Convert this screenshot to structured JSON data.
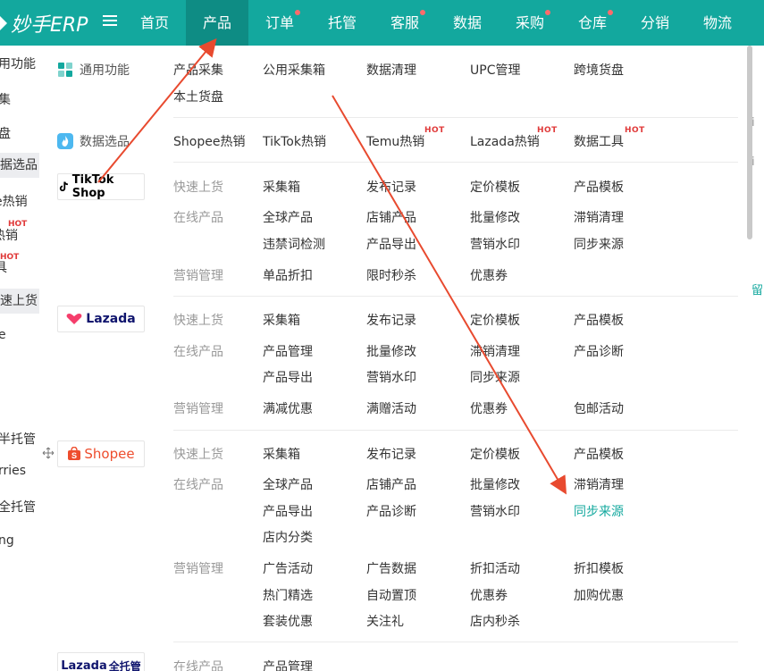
{
  "header": {
    "logo_text": "妙手ERP",
    "nav": [
      {
        "label": "首页",
        "dot": false,
        "active": false
      },
      {
        "label": "产品",
        "dot": false,
        "active": true
      },
      {
        "label": "订单",
        "dot": true,
        "active": false
      },
      {
        "label": "托管",
        "dot": false,
        "active": false
      },
      {
        "label": "客服",
        "dot": true,
        "active": false
      },
      {
        "label": "数据",
        "dot": false,
        "active": false
      },
      {
        "label": "采购",
        "dot": true,
        "active": false
      },
      {
        "label": "仓库",
        "dot": true,
        "active": false
      },
      {
        "label": "分销",
        "dot": false,
        "active": false
      },
      {
        "label": "物流",
        "dot": false,
        "active": false
      }
    ],
    "colors": {
      "bar": "#13a89e",
      "active": "#0e8c84",
      "dot": "#ff6b6b"
    }
  },
  "left_sidebar": {
    "items": [
      "用功能",
      "集",
      "盘",
      "据选品",
      "e热销",
      "热销",
      "具",
      "速上货",
      "e",
      "半托管",
      "rries",
      "全托管",
      "ng"
    ],
    "hot": "HOT"
  },
  "right_edge": {
    "texts": [
      "i",
      "i",
      "留"
    ]
  },
  "dropdown": {
    "general": {
      "label": "通用功能",
      "items": [
        "产品采集",
        "公用采集箱",
        "数据清理",
        "UPC管理",
        "跨境货盘",
        "本土货盘"
      ]
    },
    "data_selection": {
      "label": "数据选品",
      "items": [
        {
          "label": "Shopee热销",
          "hot": ""
        },
        {
          "label": "TikTok热销",
          "hot": ""
        },
        {
          "label": "Temu热销",
          "hot": "HOT"
        },
        {
          "label": "Lazada热销",
          "hot": "HOT"
        },
        {
          "label": "数据工具",
          "hot": "HOT"
        }
      ]
    },
    "tiktok": {
      "logo": "TikTok Shop",
      "rows": [
        {
          "cat": "快速上货",
          "items": [
            "采集箱",
            "发布记录",
            "定价模板",
            "产品模板"
          ]
        },
        {
          "cat": "在线产品",
          "items": [
            "全球产品",
            "店铺产品",
            "批量修改",
            "滞销清理"
          ]
        },
        {
          "cat": "",
          "items": [
            "违禁词检测",
            "产品导出",
            "营销水印",
            "同步来源"
          ]
        },
        {
          "cat": "营销管理",
          "items": [
            "单品折扣",
            "限时秒杀",
            "优惠券",
            ""
          ]
        }
      ]
    },
    "lazada": {
      "logo": "Lazada",
      "rows": [
        {
          "cat": "快速上货",
          "items": [
            "采集箱",
            "发布记录",
            "定价模板",
            "产品模板"
          ]
        },
        {
          "cat": "在线产品",
          "items": [
            "产品管理",
            "批量修改",
            "滞销清理",
            "产品诊断"
          ]
        },
        {
          "cat": "",
          "items": [
            "产品导出",
            "营销水印",
            "同步来源",
            ""
          ]
        },
        {
          "cat": "营销管理",
          "items": [
            "满减优惠",
            "满赠活动",
            "优惠券",
            "包邮活动"
          ]
        }
      ]
    },
    "shopee": {
      "logo": "Shopee",
      "rows": [
        {
          "cat": "快速上货",
          "items": [
            "采集箱",
            "发布记录",
            "定价模板",
            "产品模板"
          ]
        },
        {
          "cat": "在线产品",
          "items": [
            "全球产品",
            "店铺产品",
            "批量修改",
            "滞销清理"
          ]
        },
        {
          "cat": "",
          "items": [
            "产品导出",
            "产品诊断",
            "营销水印",
            "同步来源"
          ]
        },
        {
          "cat": "",
          "items": [
            "店内分类",
            "",
            "",
            ""
          ]
        },
        {
          "cat": "营销管理",
          "items": [
            "广告活动",
            "广告数据",
            "折扣活动",
            "折扣模板"
          ]
        },
        {
          "cat": "",
          "items": [
            "热门精选",
            "自动置顶",
            "优惠券",
            "加购优惠"
          ]
        },
        {
          "cat": "",
          "items": [
            "套装优惠",
            "关注礼",
            "店内秒杀",
            ""
          ]
        }
      ]
    },
    "lazada_full": {
      "logo_en": "Lazada",
      "logo_cn": "全托管",
      "rows": [
        {
          "cat": "在线产品",
          "items": [
            "产品管理"
          ]
        }
      ]
    }
  },
  "colors": {
    "accent": "#13a89e",
    "hot": "#e03a3a",
    "arrow": "#e84a2f",
    "tiktok_logo": "#000000",
    "lazada_logo": "#0f146d",
    "shopee_logo": "#ee4d2d"
  }
}
